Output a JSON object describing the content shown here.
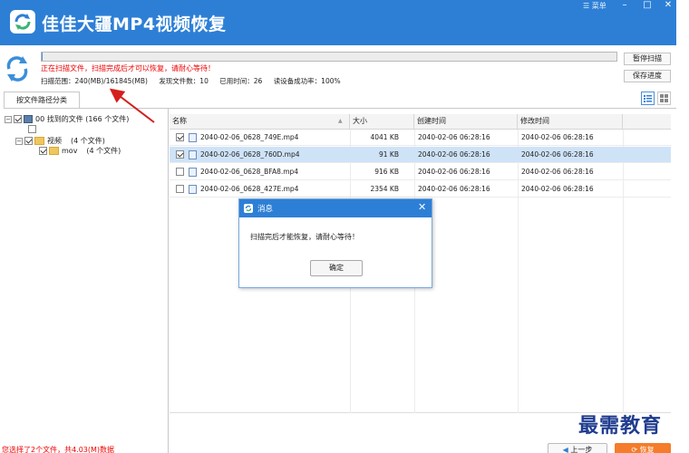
{
  "app": {
    "title": "佳佳大疆MP4视频恢复",
    "menu_label": "菜单",
    "minimize": "–",
    "maximize": "□",
    "close": "✕",
    "brand_color": "#2d7fd6"
  },
  "scan": {
    "progress_fraction": 0.0015,
    "status": "正在扫描文件，扫描完成后才可以恢复，请耐心等待！",
    "range": "扫描范围：240(MB)/161845(MB)",
    "found": "发现文件数：10",
    "elapsed": "已用时间：26",
    "read_success": "读设备成功率：100%",
    "pause_label": "暂停扫描",
    "save_label": "保存进度"
  },
  "tabs": {
    "by_path": "按文件路径分类"
  },
  "tree": {
    "root": "00 找到的文件 (166 个文件)",
    "video": "视频",
    "video_count": "(4 个文件)",
    "mov": "mov",
    "mov_count": "(4 个文件)"
  },
  "table": {
    "headers": [
      "名称",
      "大小",
      "创建时间",
      "修改时间"
    ],
    "rows": [
      {
        "name": "2040-02-06_0628_749E.mp4",
        "size": "4041 KB",
        "created": "2040-02-06  06:28:16",
        "modified": "2040-02-06  06:28:16",
        "checked": true,
        "selected": false
      },
      {
        "name": "2040-02-06_0628_760D.mp4",
        "size": "91 KB",
        "created": "2040-02-06  06:28:16",
        "modified": "2040-02-06  06:28:16",
        "checked": true,
        "selected": true
      },
      {
        "name": "2040-02-06_0628_BFA8.mp4",
        "size": "916 KB",
        "created": "2040-02-06  06:28:16",
        "modified": "2040-02-06  06:28:16",
        "checked": false,
        "selected": false
      },
      {
        "name": "2040-02-06_0628_427E.mp4",
        "size": "2354 KB",
        "created": "2040-02-06  06:28:16",
        "modified": "2040-02-06  06:28:16",
        "checked": false,
        "selected": false
      }
    ]
  },
  "dialog": {
    "title": "消息",
    "message": "扫描完后才能恢复，请耐心等待！",
    "ok_label": "确定",
    "close": "✕"
  },
  "footer": {
    "selection": "您选择了2个文件，共4.03(M)数据",
    "prev_label": "上一步",
    "recover_label": "恢复",
    "watermark": "最需教育",
    "recover_color": "#f47c2a"
  }
}
